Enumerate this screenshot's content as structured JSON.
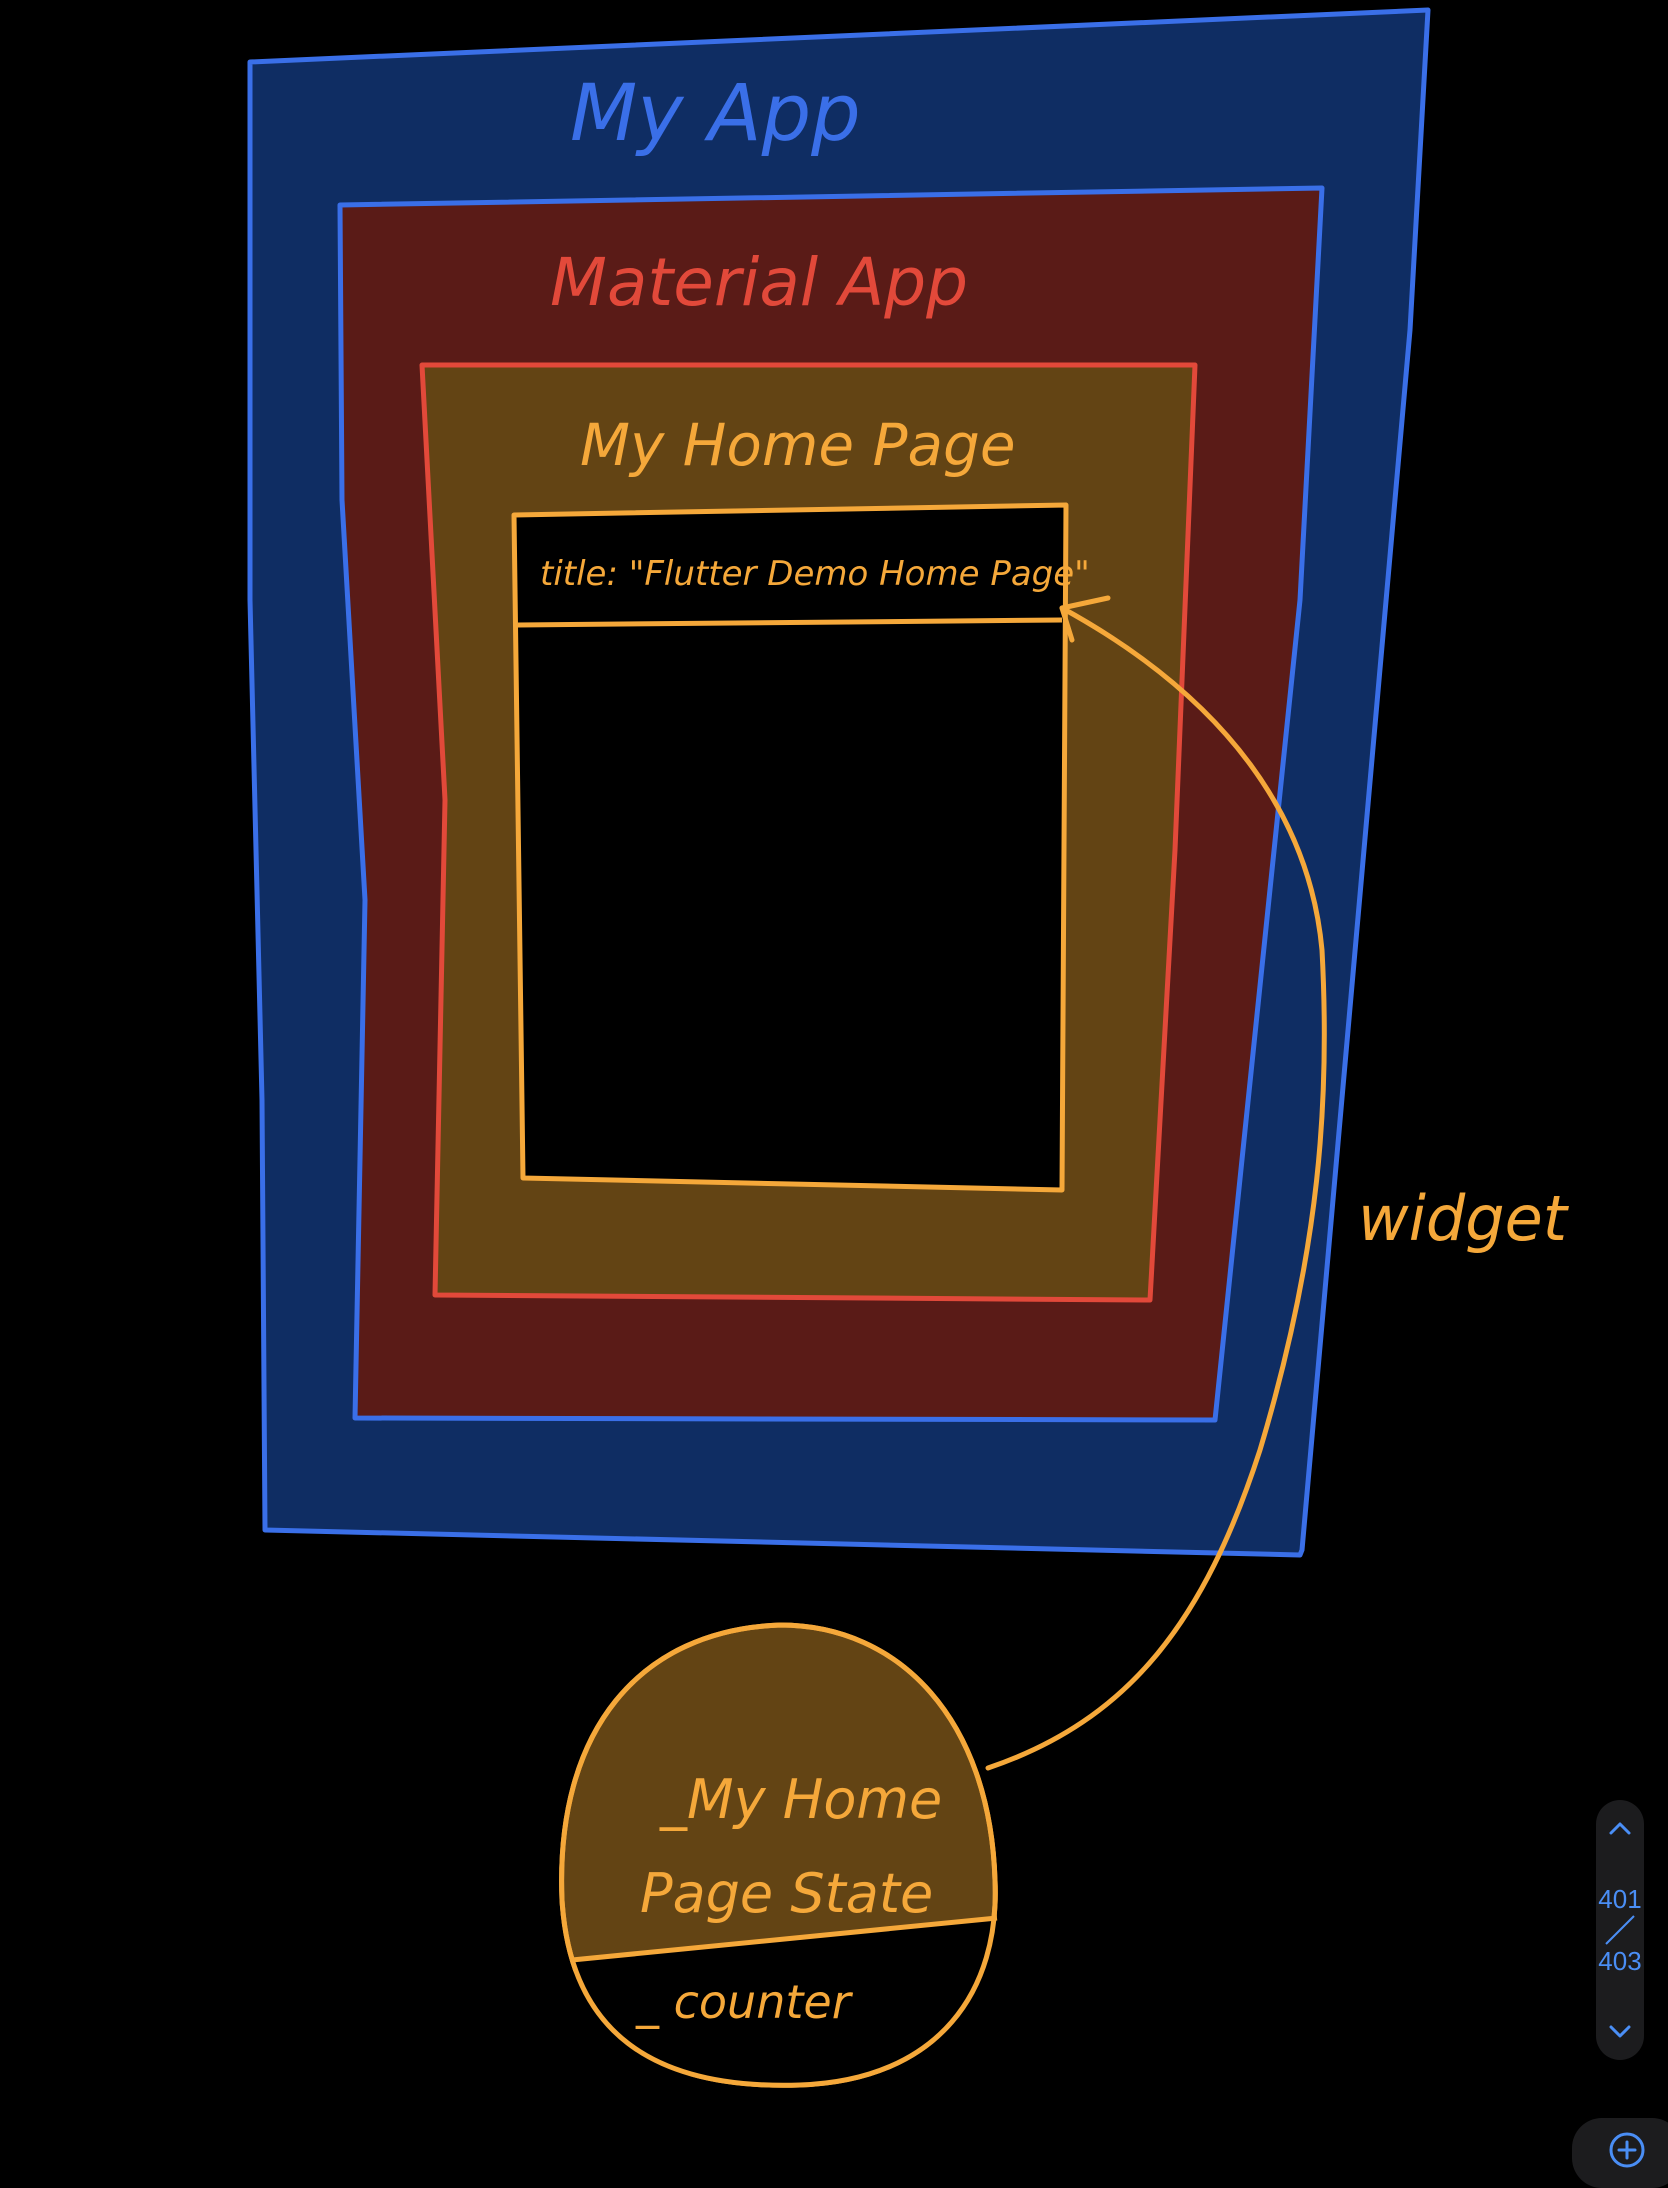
{
  "diagram": {
    "labels": {
      "my_app": "My App",
      "material_app": "Material App",
      "my_home_page": "My Home Page",
      "title_field": "title: \"Flutter Demo Home Page\"",
      "widget": "widget",
      "state_line1": "_My Home",
      "state_line2": "Page State",
      "counter": "_ counter"
    },
    "colors": {
      "blue_fill": "#0f2d63",
      "blue_stroke": "#3a6fe8",
      "red_fill": "#5a1b17",
      "red_stroke": "#e2493a",
      "orange_fill": "#634414",
      "orange_stroke": "#f5a83a",
      "background": "#000000"
    }
  },
  "pager": {
    "current": "401",
    "total": "403",
    "up_icon": "chevron-up-icon",
    "down_icon": "chevron-down-icon"
  },
  "zoom": {
    "icon": "zoom-in-icon"
  }
}
